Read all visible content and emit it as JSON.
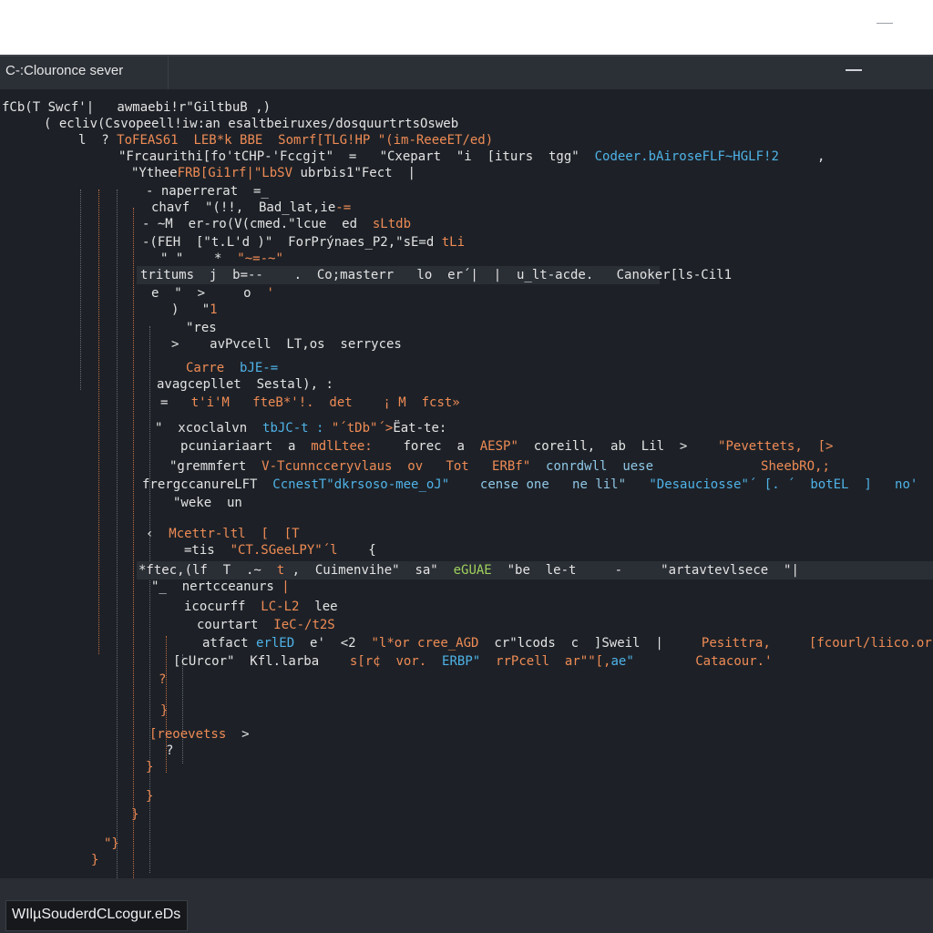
{
  "window": {
    "title": "C-:Clouronce sever"
  },
  "status": {
    "label": "WIlµSouderdCLcogur.eDs"
  },
  "code": {
    "l01": {
      "a": "fCb(T Swcf'|   awmaebi!r\"GiltbuB ,)"
    },
    "l02": {
      "a": "( ecliv(Csvopeell!iw:an esaltbeiruxes/dosquurtrtsOsweb"
    },
    "l03": {
      "a": "l  ? ",
      "b": "ToFEAS61  LEB*k BBE  Somrf[TLG!HP ",
      "c": "\"(im-ReeeET/ed)"
    },
    "l04": {
      "a": "\"Frcaurithi[fo'tCHP-'Fccgjt\"  =   \"Cxepart  \"i  [iturs  tgg\"",
      "b": "  Codeer.bAiroseFLF~HGLF!2",
      "c": "     ,"
    },
    "l05": {
      "a": "\"Ythee",
      "b": "FRB[Gi1rf|\"LbSV",
      "c": " ubrbis1\"Fect  |"
    },
    "l06": {
      "a": "- naperrerat  =_"
    },
    "l07": {
      "a": "chavf  \"(!!,  Bad_lat,ie",
      "b": "-="
    },
    "l08": {
      "a": "- ~M  er-ro(V(cmed.\"lcue  ed",
      "b": "  sLtdb"
    },
    "l09": {
      "a": "-(FEH  [\"t.L'd )\"  ForPrýnaes_P2,\"sE=d ",
      "b": "tLi"
    },
    "l10": {
      "a": "\" \"    *  ",
      "b": "\"~=-~\""
    },
    "l11": {
      "a": "tritums  j  b=--    .  Co;masterr   lo  er´|  |  u_lt-acde.   Canoker[ls-Cil1"
    },
    "l12": {
      "a": "e  \"  >     o  ",
      "b": "'"
    },
    "l13": {
      "a": ")   \"",
      "b": "1"
    },
    "l14": {
      "a": "\"res"
    },
    "l15": {
      "a": ">    avPvcell  LT,os  serryces"
    },
    "l16": {
      "a": "Carre  ",
      "b": "bJE-="
    },
    "l17": {
      "a": "avagcepllet  Sestal),",
      "b": " :"
    },
    "l18": {
      "a": "=   ",
      "b": "t'i'M   fteB*'!.  det    ¡ M  fcst»"
    },
    "l19": {
      "a": "\"  xcoclalvn  ",
      "b": "tbJC-t :",
      "c": " \"´tDb\"´>",
      "d": "Ëat-te:"
    },
    "l20": {
      "a": "pcuniariaart  a  ",
      "b": "mdlLtee:",
      "c": "    forec  a  ",
      "d": "AESP\"",
      "e": "  coreill,  ab  Lil  >",
      "f": "    \"Pevettets,  [>"
    },
    "l21": {
      "a": "\"gremmfert  ",
      "b": "V-Tcunncceryvlaus  ov   Tot   ERBf\"",
      "c": "  conrdwll  uese",
      "d": "              SheebRO,;"
    },
    "l22": {
      "a": "frergccanureLFT  ",
      "b": "CcnestT\"dkrsoso-mee_oJ\"",
      "c": "    cense one   ne lil\"",
      "d": "   \"Desauciosse\"´ [. ´  botEL  ]",
      "e": "   no'"
    },
    "l23": {
      "a": "\"weke  un"
    },
    "l24": {
      "a": "‹  ",
      "b": "Mcettr-ltl  [  [T"
    },
    "l25": {
      "a": "=tis  ",
      "b": "\"CT.SGeeLPY\"´l",
      "c": "    {"
    },
    "l26": {
      "a": "*ftec,(lf  T  .~  ",
      "b": "t",
      "c": " ,  Cuimenvihe\"  sa\"",
      "d": "  eGUAE",
      "e": "  \"be  le-t     -     \"artavtevlsece  \"|"
    },
    "l27": {
      "a": "\"_  nertcceanurs",
      "b": " |"
    },
    "l28": {
      "a": "icocurff  ",
      "b": "LC-L2",
      "c": "  lee"
    },
    "l29": {
      "a": "courtart  ",
      "b": "IeC-/t2S"
    },
    "l30": {
      "a": "atfact ",
      "b": "erlED",
      "c": "  e'  <2  ",
      "d": "\"l*or cree_AGD",
      "e": "  cr\"lcods  c  ]Sweil  |",
      "f": "     Pesittra,     [fcourl/liico.ors."
    },
    "l31": {
      "a": "[cUrcor\"  Kfl.larba  ",
      "b": "  s[r¢  vor.",
      "c": "  ERBP\"",
      "d": "  rrPcell  ar\"\"[,",
      "e": "ae\"",
      "f": "        Catacour.'"
    },
    "l32": {
      "a": "?"
    },
    "l33": {
      "a": "}"
    },
    "l34": {
      "a": "[reoevetss",
      "b": "  >"
    },
    "l35": {
      "a": "?"
    },
    "l36": {
      "a": "}"
    },
    "l37": {
      "a": "}"
    },
    "l38": {
      "a": "}"
    },
    "l39": {
      "a": "\"}"
    },
    "l40": {
      "a": "}"
    }
  }
}
